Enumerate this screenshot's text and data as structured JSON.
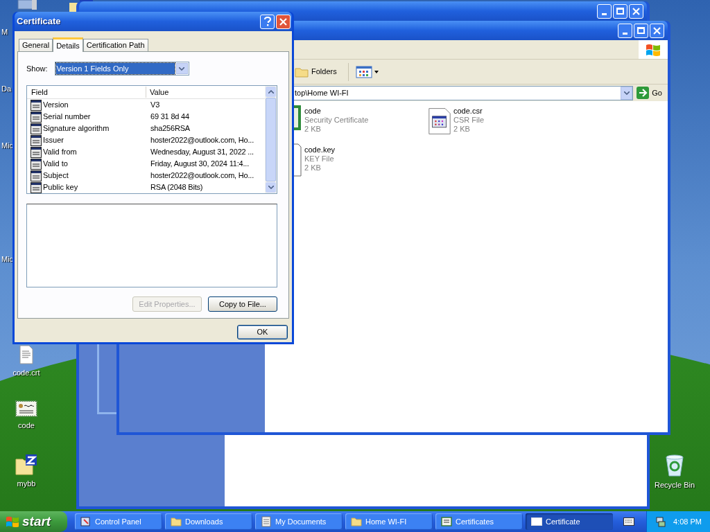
{
  "desktop": {
    "edge_labels": [
      "M",
      "Da",
      "Mic",
      "Mic"
    ],
    "icons": [
      {
        "label": "code.crt",
        "kind": "document"
      },
      {
        "label": "code",
        "kind": "certificate"
      },
      {
        "label": "mybb",
        "kind": "zip-folder"
      },
      {
        "label": "Recycle Bin",
        "kind": "recycle-bin"
      }
    ]
  },
  "explorer": {
    "toolbar": {
      "folders_label": "Folders"
    },
    "address": "top\\Home WI-FI",
    "go_label": "Go",
    "files": [
      {
        "name": "code",
        "type": "Security Certificate",
        "size": "2 KB",
        "kind": "certificate"
      },
      {
        "name": "code.csr",
        "type": "CSR File",
        "size": "2 KB",
        "kind": "csr"
      },
      {
        "name": "code.key",
        "type": "KEY File",
        "size": "2 KB",
        "kind": "key"
      }
    ]
  },
  "dialog": {
    "title": "Certificate",
    "tabs": [
      {
        "label": "General",
        "selected": false
      },
      {
        "label": "Details",
        "selected": true
      },
      {
        "label": "Certification Path",
        "selected": false
      }
    ],
    "show_label": "Show:",
    "show_value": "Version 1 Fields Only",
    "columns": [
      "Field",
      "Value"
    ],
    "rows": [
      {
        "field": "Version",
        "value": "V3"
      },
      {
        "field": "Serial number",
        "value": "69 31 8d 44"
      },
      {
        "field": "Signature algorithm",
        "value": "sha256RSA"
      },
      {
        "field": "Issuer",
        "value": "hoster2022@outlook.com, Ho..."
      },
      {
        "field": "Valid from",
        "value": "Wednesday, August 31, 2022 ..."
      },
      {
        "field": "Valid to",
        "value": "Friday, August 30, 2024 11:4..."
      },
      {
        "field": "Subject",
        "value": "hoster2022@outlook.com, Ho..."
      },
      {
        "field": "Public key",
        "value": "RSA (2048 Bits)"
      }
    ],
    "buttons": [
      {
        "label": "Edit Properties...",
        "disabled": true
      },
      {
        "label": "Copy to File...",
        "disabled": false
      }
    ],
    "ok_label": "OK"
  },
  "taskbar": {
    "start_label": "start",
    "items": [
      {
        "label": "Control Panel",
        "kind": "control-panel",
        "selected": false
      },
      {
        "label": "Downloads",
        "kind": "folder",
        "selected": false
      },
      {
        "label": "My Documents",
        "kind": "documents",
        "selected": false
      },
      {
        "label": "Home WI-FI",
        "kind": "folder",
        "selected": false
      },
      {
        "label": "Certificates",
        "kind": "certificates",
        "selected": false
      },
      {
        "label": "Certificate",
        "kind": "window",
        "selected": true
      }
    ],
    "clock": "4:08 PM"
  }
}
